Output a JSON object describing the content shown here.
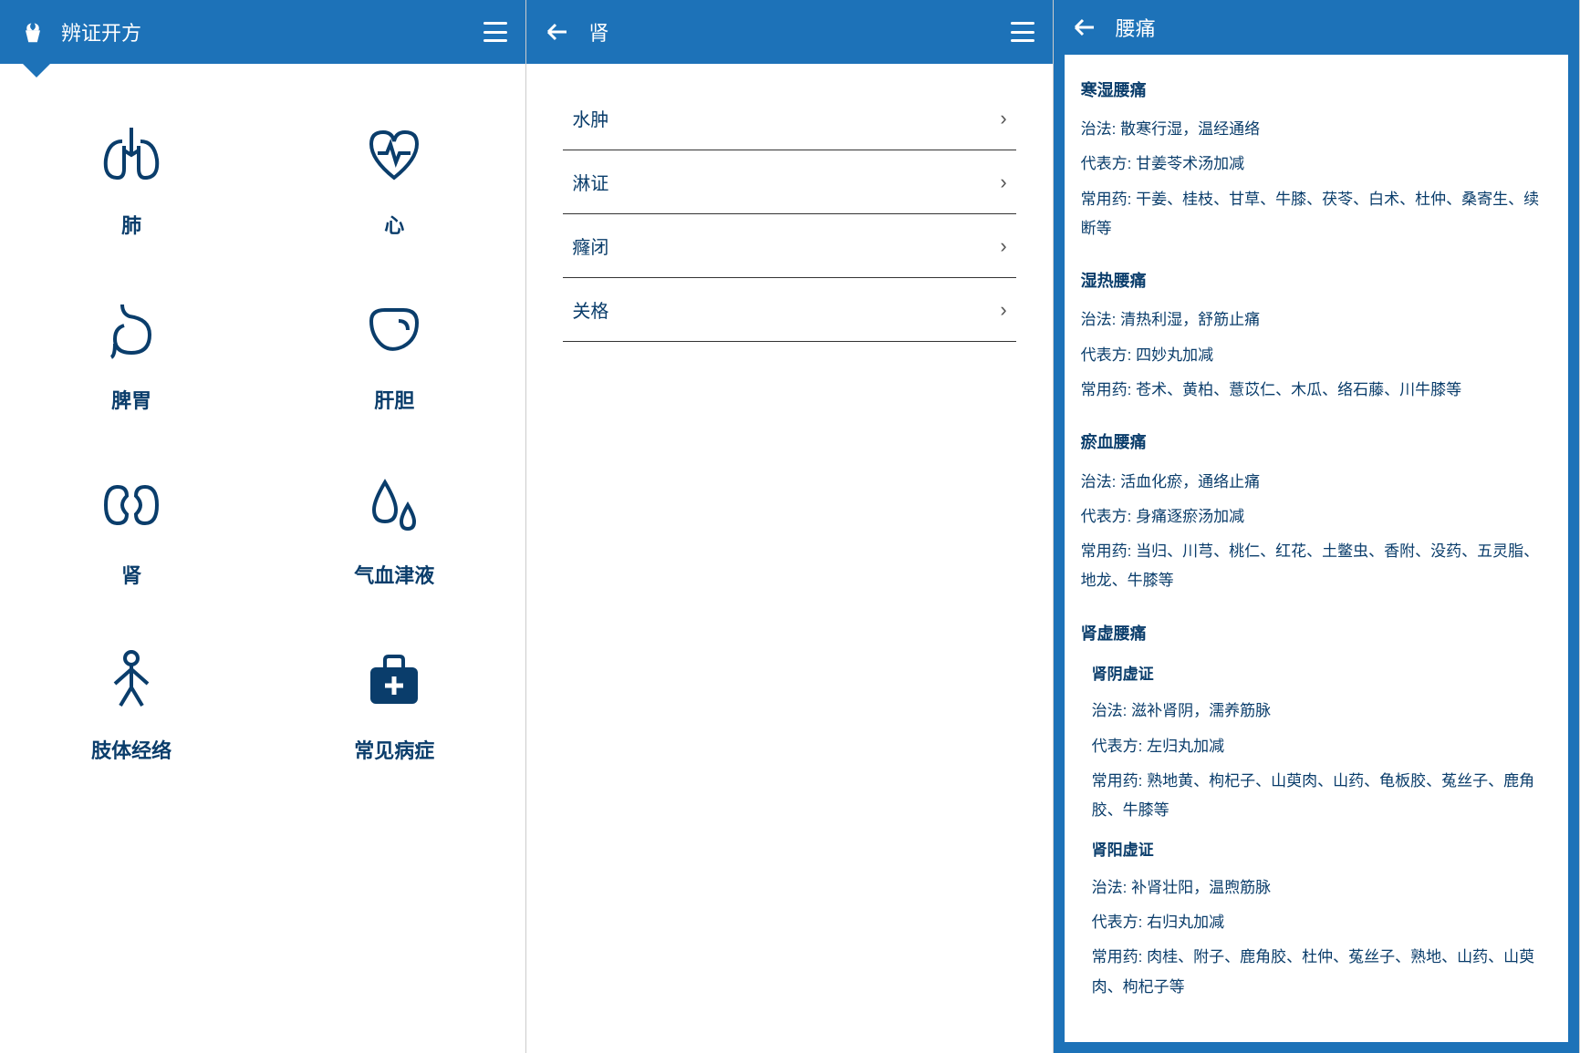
{
  "panel1": {
    "title": "辨证开方",
    "categories": [
      {
        "label": "肺",
        "icon": "lungs"
      },
      {
        "label": "心",
        "icon": "heart"
      },
      {
        "label": "脾胃",
        "icon": "stomach"
      },
      {
        "label": "肝胆",
        "icon": "liver"
      },
      {
        "label": "肾",
        "icon": "kidney"
      },
      {
        "label": "气血津液",
        "icon": "drops"
      },
      {
        "label": "肢体经络",
        "icon": "body"
      },
      {
        "label": "常见病症",
        "icon": "medkit"
      }
    ]
  },
  "panel2": {
    "title": "肾",
    "items": [
      "水肿",
      "淋证",
      "癃闭",
      "关格"
    ]
  },
  "panel3": {
    "title": "腰痛",
    "label_treatment": "治法:",
    "label_formula": "代表方:",
    "label_herbs": "常用药:",
    "sections": [
      {
        "title": "寒湿腰痛",
        "treatment": "散寒行湿，温经通络",
        "formula": "甘姜苓术汤加减",
        "herbs": "干姜、桂枝、甘草、牛膝、茯苓、白术、杜仲、桑寄生、续断等"
      },
      {
        "title": "湿热腰痛",
        "treatment": "清热利湿，舒筋止痛",
        "formula": "四妙丸加减",
        "herbs": "苍术、黄柏、薏苡仁、木瓜、络石藤、川牛膝等"
      },
      {
        "title": "瘀血腰痛",
        "treatment": "活血化瘀，通络止痛",
        "formula": "身痛逐瘀汤加减",
        "herbs": "当归、川芎、桃仁、红花、土鳖虫、香附、没药、五灵脂、地龙、牛膝等"
      },
      {
        "title": "肾虚腰痛",
        "subsections": [
          {
            "title": "肾阴虚证",
            "treatment": "滋补肾阴，濡养筋脉",
            "formula": "左归丸加减",
            "herbs": "熟地黄、枸杞子、山萸肉、山药、龟板胶、菟丝子、鹿角胶、牛膝等"
          },
          {
            "title": "肾阳虚证",
            "treatment": "补肾壮阳，温煦筋脉",
            "formula": "右归丸加减",
            "herbs": "肉桂、附子、鹿角胶、杜仲、菟丝子、熟地、山药、山萸肉、枸杞子等"
          }
        ]
      }
    ]
  }
}
